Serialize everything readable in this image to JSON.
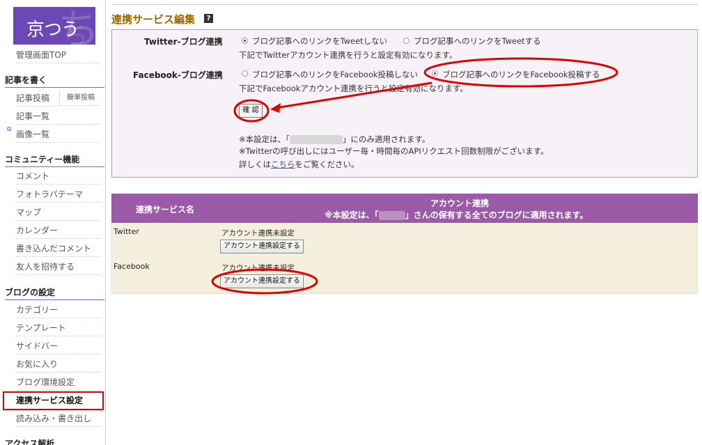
{
  "logo": {
    "text": "京つう"
  },
  "sidebar": {
    "top_link": "管理画面TOP",
    "sections": [
      {
        "heading": "記事を書く",
        "items": [
          "記事投稿",
          "記事一覧",
          "画像一覧"
        ],
        "sub": "簡単投稿"
      },
      {
        "heading": "コミュニティー機能",
        "items": [
          "コメント",
          "フォトラバテーマ",
          "マップ",
          "カレンダー",
          "書き込んだコメント",
          "友人を招待する"
        ]
      },
      {
        "heading": "ブログの設定",
        "items": [
          "カテゴリー",
          "テンプレート",
          "サイドバー",
          "お気に入り",
          "ブログ環境設定",
          "連携サービス設定",
          "読み込み・書き出し"
        ]
      },
      {
        "heading": "アクセス解析"
      }
    ],
    "active": "連携サービス設定"
  },
  "page": {
    "title": "連携サービス編集",
    "help_icon": "?"
  },
  "settings": {
    "twitter": {
      "label": "Twitter-ブログ連携",
      "option_off": "ブログ記事へのリンクをTweetしない",
      "option_on": "ブログ記事へのリンクをTweetする",
      "selected": "off",
      "note": "下記でTwitterアカウント連携を行うと設定有効になります。"
    },
    "facebook": {
      "label": "Facebook-ブログ連携",
      "option_off": "ブログ記事へのリンクをFacebook投稿しない",
      "option_on": "ブログ記事へのリンクをFacebook投稿する",
      "selected": "on",
      "note": "下記でFacebookアカウント連携を行うと設定有効になります。"
    },
    "confirm_label": "確 認",
    "notice1_a": "※本設定は、「",
    "notice1_b": "」にのみ適用されます。",
    "notice2": "※Twitterの呼び出しにはユーザー毎・時間毎のAPIリクエスト回数制限がございます。",
    "notice3_a": "詳しくは",
    "notice3_link": "こちら",
    "notice3_b": "をご覧ください。"
  },
  "accounts": {
    "col_service": "連携サービス名",
    "col_account": "アカウント連携",
    "col_account_note_a": "※本設定は、「",
    "col_account_note_b": "」さんの保有する全てのブログに適用されます。",
    "rows": [
      {
        "service": "Twitter",
        "status": "アカウント連携未設定",
        "button": "アカウント連携設定する"
      },
      {
        "service": "Facebook",
        "status": "アカウント連携未設定",
        "button": "アカウント連携設定する"
      }
    ]
  },
  "colors": {
    "annotation": "#e00000",
    "brand_purple": "#6b48b3",
    "table_header": "#9b5aa8",
    "title": "#9a6700"
  }
}
